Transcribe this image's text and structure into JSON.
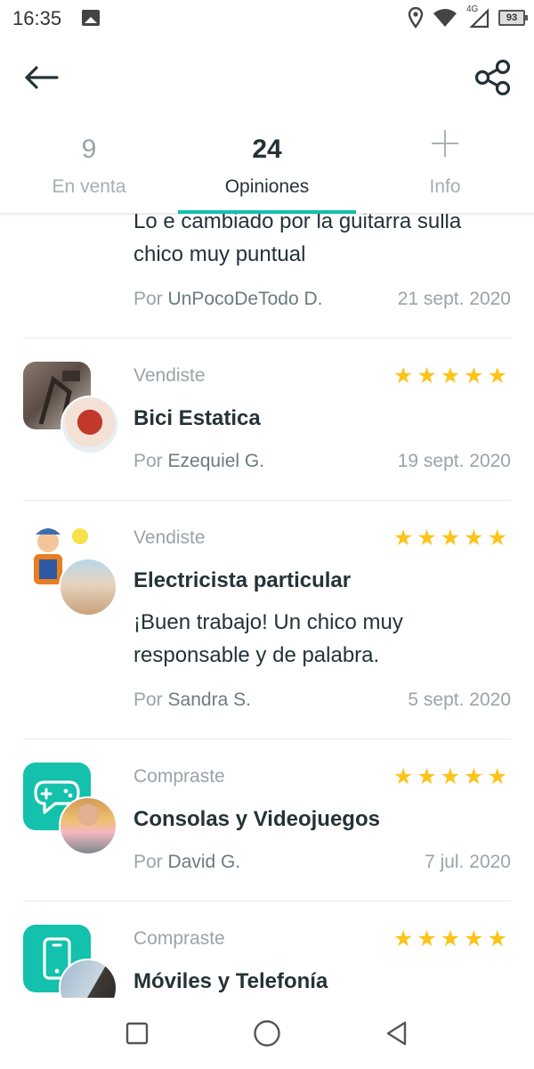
{
  "status_bar": {
    "time": "16:35",
    "network": "4G",
    "battery": "93"
  },
  "tabs": [
    {
      "count": "9",
      "label": "En venta"
    },
    {
      "count": "24",
      "label": "Opiniones"
    },
    {
      "count": "",
      "label": "Info"
    }
  ],
  "reviews": [
    {
      "comment": "Lo e cambiado por la guitarra sulla chico muy puntual",
      "by_prefix": "Por",
      "by_name": "UnPocoDeTodo D.",
      "date": "21 sept. 2020"
    },
    {
      "kind": "Vendiste",
      "title": "Bici Estatica",
      "by_prefix": "Por",
      "by_name": "Ezequiel G.",
      "date": "19 sept. 2020",
      "rating": 5
    },
    {
      "kind": "Vendiste",
      "title": "Electricista particular",
      "comment": "¡Buen trabajo! Un chico muy responsable y de palabra.",
      "by_prefix": "Por",
      "by_name": "Sandra S.",
      "date": "5 sept. 2020",
      "rating": 5
    },
    {
      "kind": "Compraste",
      "title": "Consolas y Videojuegos",
      "by_prefix": "Por",
      "by_name": "David G.",
      "date": "7 jul. 2020",
      "rating": 5
    },
    {
      "kind": "Compraste",
      "title": "Móviles y Telefonía",
      "rating": 5
    }
  ],
  "colors": {
    "accent": "#13c1ac",
    "star": "#fcc419",
    "text": "#253238",
    "muted": "#9aa4a8"
  },
  "icons": [
    "back-arrow-icon",
    "share-icon",
    "plus-icon",
    "star-icon",
    "gamepad-icon",
    "phone-icon",
    "recent-apps-icon",
    "home-icon",
    "back-nav-icon"
  ]
}
